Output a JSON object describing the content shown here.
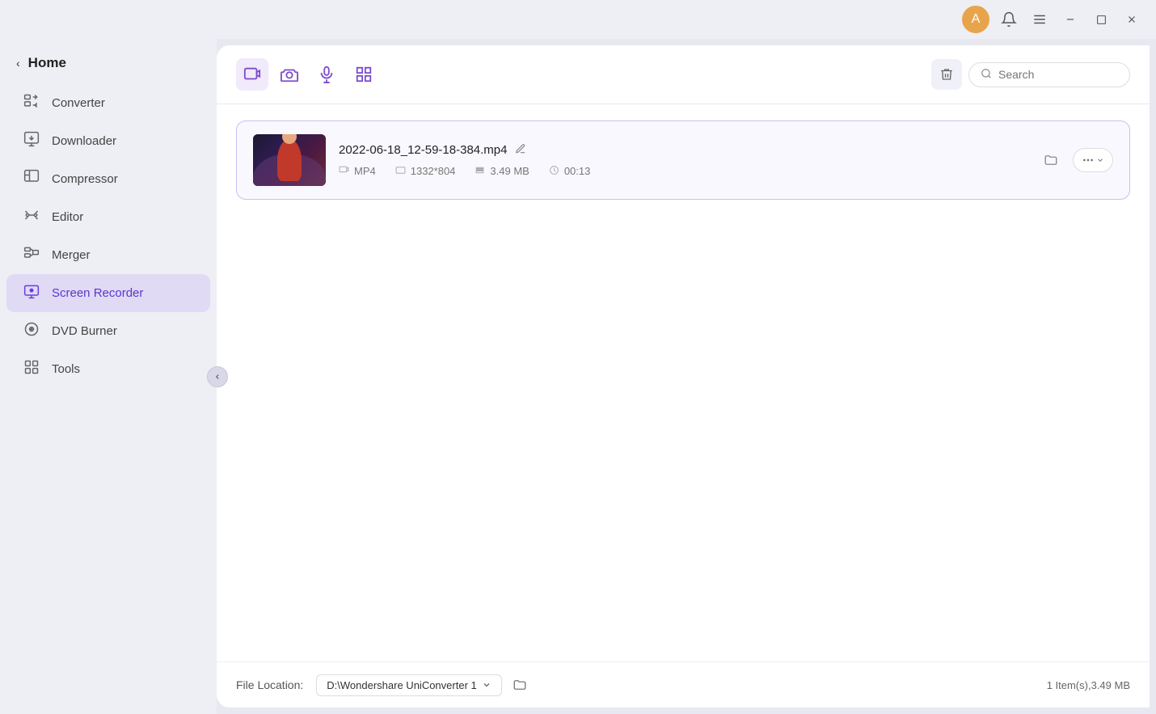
{
  "titleBar": {
    "avatarIcon": "👤",
    "bellIcon": "🔔",
    "menuIcon": "☰",
    "minimizeIcon": "—",
    "maximizeIcon": "☐",
    "closeIcon": "✕"
  },
  "sidebar": {
    "homeLabel": "Home",
    "backChevron": "‹",
    "collapseChevron": "‹",
    "items": [
      {
        "id": "converter",
        "label": "Converter",
        "icon": "⊡"
      },
      {
        "id": "downloader",
        "label": "Downloader",
        "icon": "⊞"
      },
      {
        "id": "compressor",
        "label": "Compressor",
        "icon": "⊟"
      },
      {
        "id": "editor",
        "label": "Editor",
        "icon": "✂"
      },
      {
        "id": "merger",
        "label": "Merger",
        "icon": "⊞"
      },
      {
        "id": "screen-recorder",
        "label": "Screen Recorder",
        "icon": "▣",
        "active": true
      },
      {
        "id": "dvd-burner",
        "label": "DVD Burner",
        "icon": "◎"
      },
      {
        "id": "tools",
        "label": "Tools",
        "icon": "⊞"
      }
    ]
  },
  "toolbar": {
    "tabs": [
      {
        "id": "video",
        "icon": "▣",
        "active": true
      },
      {
        "id": "camera",
        "icon": "◎"
      },
      {
        "id": "mic",
        "icon": "♦"
      },
      {
        "id": "grid",
        "icon": "⊞"
      }
    ],
    "trashIcon": "🗑",
    "searchPlaceholder": "Search",
    "searchIcon": "🔍"
  },
  "fileList": {
    "items": [
      {
        "id": "file-1",
        "name": "2022-06-18_12-59-18-384.mp4",
        "format": "MP4",
        "resolution": "1332*804",
        "size": "3.49 MB",
        "duration": "00:13"
      }
    ]
  },
  "footer": {
    "fileLocationLabel": "File Location:",
    "locationPath": "D:\\Wondershare UniConverter 1",
    "dropdownChevron": "▾",
    "folderIcon": "📁",
    "countText": "1 Item(s),3.49 MB"
  }
}
